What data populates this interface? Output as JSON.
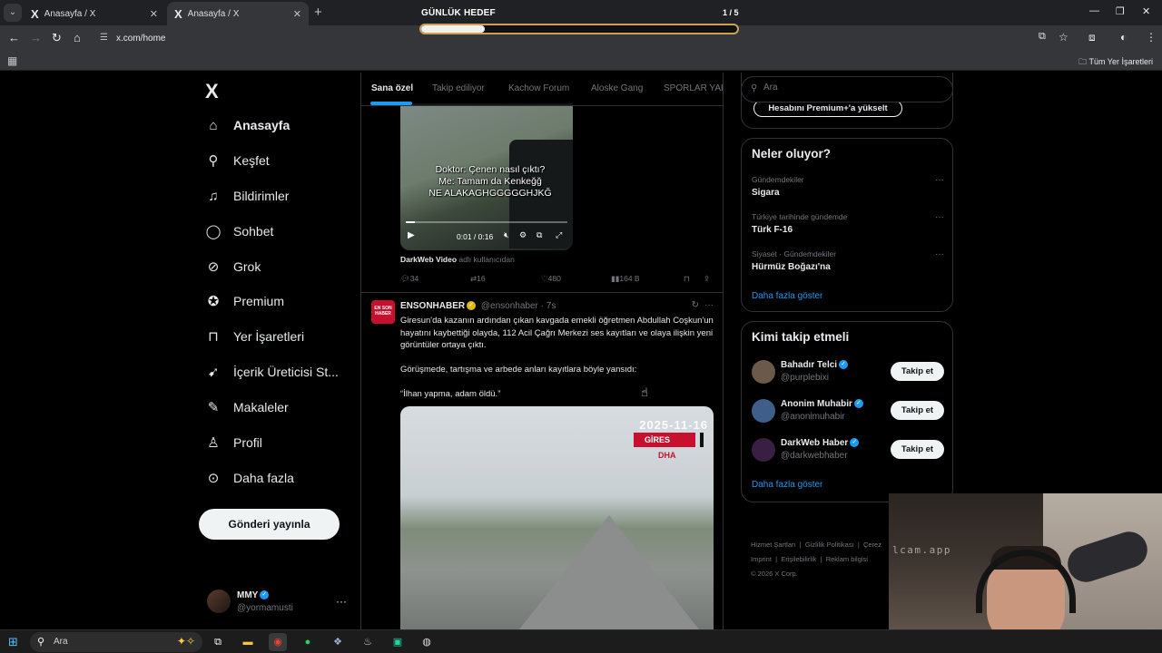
{
  "browser": {
    "tabs": [
      {
        "icon": "X",
        "label": "Anasayfa / X",
        "close": "✕"
      },
      {
        "icon": "X",
        "label": "Anasayfa / X",
        "close": "✕"
      }
    ],
    "new_tab": "+",
    "goal": {
      "title": "GÜNLÜK HEDEF",
      "count": "1 / 5",
      "progress": 0.2
    },
    "url": "x.com/home",
    "bookmarks_all": "Tüm Yer İşaretleri"
  },
  "sidebar": {
    "logo": "X",
    "items": [
      {
        "label": "Anasayfa",
        "icon": "home-icon",
        "glyph": "⌂"
      },
      {
        "label": "Keşfet",
        "icon": "search-icon",
        "glyph": "⌕"
      },
      {
        "label": "Bildirimler",
        "icon": "bell-icon",
        "glyph": "🔔"
      },
      {
        "label": "Sohbet",
        "icon": "chat-icon",
        "glyph": "💬"
      },
      {
        "label": "Grok",
        "icon": "grok-icon",
        "glyph": "⊘"
      },
      {
        "label": "Premium",
        "icon": "premium-icon",
        "glyph": "✪"
      },
      {
        "label": "Yer İşaretleri",
        "icon": "bookmark-icon",
        "glyph": "🔖"
      },
      {
        "label": "İçerik Üreticisi St...",
        "icon": "rocket-icon",
        "glyph": "🚀"
      },
      {
        "label": "Makaleler",
        "icon": "article-icon",
        "glyph": "📝"
      },
      {
        "label": "Profil",
        "icon": "profile-icon",
        "glyph": "👤"
      },
      {
        "label": "Daha fazla",
        "icon": "more-icon",
        "glyph": "⋯"
      }
    ],
    "post_button": "Gönderi yayınla",
    "account": {
      "name": "MMY",
      "handle": "@yormamusti",
      "menu": "···"
    }
  },
  "timeline": {
    "tabs": [
      "Sana özel",
      "Takip ediliyor",
      "Kachow Forum",
      "Aloske Gang",
      "SPORLAR YAP"
    ],
    "tweet1": {
      "caption": "Doktor: Çenen nasıl çıktı?\nMe: Tamam da Kenkeğğ\nNE ALAKAGHGGGGGHJKĞ",
      "time": "0:01 / 0:16",
      "credit_name": "DarkWeb Video",
      "credit_suffix": "adlı kullanıcıdan",
      "stats": {
        "replies": "34",
        "reposts": "16",
        "likes": "480",
        "views": "164 B"
      }
    },
    "tweet2": {
      "avatar_text": "EN SON HABER",
      "name": "ENSONHABER",
      "handle": "@ensonhaber · 7s",
      "paragraphs": [
        "Giresun'da kazanın ardından çıkan kavgada emekli öğretmen Abdullah Coşkun'un hayatını kaybettiği olayda, 112 Acil Çağrı Merkezi ses kayıtları ve olaya ilişkin yeni görüntüler ortaya çıktı.",
        "Görüşmede, tartışma ve arbede anları kayıtlara böyle yansıdı:",
        "“İlhan yapma, adam öldü.”"
      ],
      "media": {
        "timestamp": "2025-11-16",
        "location": "GİRES",
        "agency": "DHA"
      }
    }
  },
  "right": {
    "search_placeholder": "Ara",
    "premium_button": "Hesabını Premium+'a yükselt",
    "trends_title": "Neler oluyor?",
    "trends": [
      {
        "context": "Gündemdekiler",
        "title": "Sigara"
      },
      {
        "context": "Türkiye tarihinde gündemde",
        "title": "Türk F-16"
      },
      {
        "context": "Siyaset · Gündemdekiler",
        "title": "Hürmüz Boğazı'na"
      }
    ],
    "show_more": "Daha fazla göster",
    "who_title": "Kimi takip etmeli",
    "who": [
      {
        "name": "Bahadır Telci",
        "handle": "@purplebixi",
        "button": "Takip et",
        "color": "#6b5a4a"
      },
      {
        "name": "Anonim Muhabir",
        "handle": "@anonimuhabir",
        "button": "Takip et",
        "color": "#3f5f8a"
      },
      {
        "name": "DarkWeb Haber",
        "handle": "@darkwebhaber",
        "button": "Takip et",
        "color": "#3a1f45"
      }
    ],
    "footer": [
      "Hizmet Şartları",
      "Gizlilik Politikası",
      "Çerez",
      "Imprint",
      "Erişilebilirlik",
      "Reklam bilgisi",
      "© 2026 X Corp."
    ]
  },
  "webcam": {
    "watermark": "lcam.app"
  },
  "taskbar": {
    "search": "Ara"
  }
}
